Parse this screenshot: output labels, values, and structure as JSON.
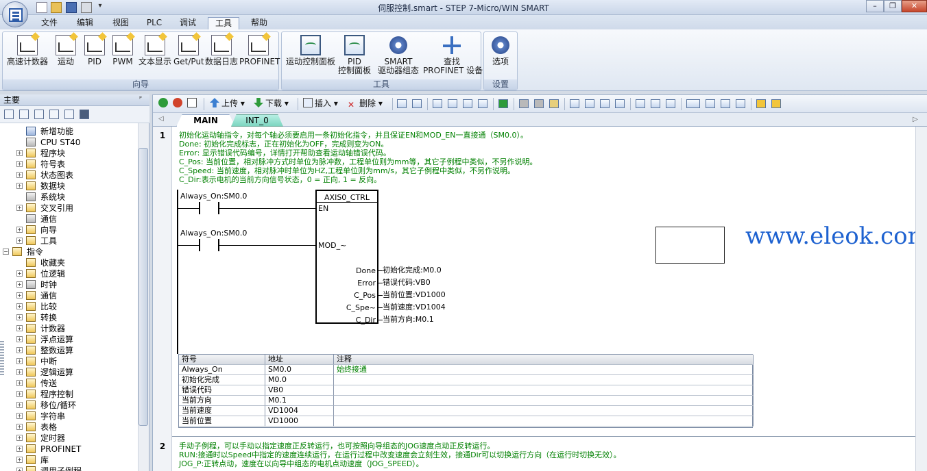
{
  "window": {
    "title": "伺服控制.smart - STEP 7-Micro/WIN SMART",
    "controls": {
      "minimize": "–",
      "maximize": "❐",
      "close": "✕"
    }
  },
  "quick_access": {
    "more": "▾"
  },
  "menu_tabs": [
    {
      "label": "文件",
      "active": false
    },
    {
      "label": "编辑",
      "active": false
    },
    {
      "label": "视图",
      "active": false
    },
    {
      "label": "PLC",
      "active": false
    },
    {
      "label": "调试",
      "active": false
    },
    {
      "label": "工具",
      "active": true
    },
    {
      "label": "帮助",
      "active": false
    }
  ],
  "ribbon": {
    "groups": [
      {
        "label": "向导",
        "buttons": [
          "高速计数器",
          "运动",
          "PID",
          "PWM",
          "文本显示",
          "Get/Put",
          "数据日志",
          "PROFINET"
        ]
      },
      {
        "label": "工具",
        "buttons": [
          "运动控制面板",
          "PID\n控制面板",
          "SMART\n驱动器组态",
          "查找\nPROFINET 设备"
        ]
      },
      {
        "label": "设置",
        "buttons": [
          "选项"
        ]
      }
    ],
    "accent_color": "#f2c53a"
  },
  "left_panel": {
    "title": "主要",
    "pin": "ᴾ",
    "tree": [
      {
        "label": "新增功能",
        "indent": 1,
        "expander": "",
        "icon": "question-icon"
      },
      {
        "label": "CPU ST40",
        "indent": 1,
        "expander": "",
        "icon": "cpu-icon"
      },
      {
        "label": "程序块",
        "indent": 1,
        "expander": "+",
        "icon": "folder-icon"
      },
      {
        "label": "符号表",
        "indent": 1,
        "expander": "+",
        "icon": "folder-icon"
      },
      {
        "label": "状态图表",
        "indent": 1,
        "expander": "+",
        "icon": "folder-icon"
      },
      {
        "label": "数据块",
        "indent": 1,
        "expander": "+",
        "icon": "folder-icon"
      },
      {
        "label": "系统块",
        "indent": 1,
        "expander": "",
        "icon": "page-icon"
      },
      {
        "label": "交叉引用",
        "indent": 1,
        "expander": "+",
        "icon": "folder-icon"
      },
      {
        "label": "通信",
        "indent": 1,
        "expander": "",
        "icon": "network-icon"
      },
      {
        "label": "向导",
        "indent": 1,
        "expander": "+",
        "icon": "wand-icon"
      },
      {
        "label": "工具",
        "indent": 1,
        "expander": "+",
        "icon": "folder-icon"
      },
      {
        "label": "指令",
        "indent": 0,
        "expander": "−",
        "icon": "folder-icon"
      },
      {
        "label": "收藏夹",
        "indent": 1,
        "expander": "",
        "icon": "folder-icon"
      },
      {
        "label": "位逻辑",
        "indent": 1,
        "expander": "+",
        "icon": "folder-icon"
      },
      {
        "label": "时钟",
        "indent": 1,
        "expander": "+",
        "icon": "clock-icon"
      },
      {
        "label": "通信",
        "indent": 1,
        "expander": "+",
        "icon": "folder-icon"
      },
      {
        "label": "比较",
        "indent": 1,
        "expander": "+",
        "icon": "folder-icon"
      },
      {
        "label": "转换",
        "indent": 1,
        "expander": "+",
        "icon": "folder-icon"
      },
      {
        "label": "计数器",
        "indent": 1,
        "expander": "+",
        "icon": "folder-icon"
      },
      {
        "label": "浮点运算",
        "indent": 1,
        "expander": "+",
        "icon": "folder-icon"
      },
      {
        "label": "整数运算",
        "indent": 1,
        "expander": "+",
        "icon": "folder-icon"
      },
      {
        "label": "中断",
        "indent": 1,
        "expander": "+",
        "icon": "folder-icon"
      },
      {
        "label": "逻辑运算",
        "indent": 1,
        "expander": "+",
        "icon": "folder-icon"
      },
      {
        "label": "传送",
        "indent": 1,
        "expander": "+",
        "icon": "folder-icon"
      },
      {
        "label": "程序控制",
        "indent": 1,
        "expander": "+",
        "icon": "folder-icon"
      },
      {
        "label": "移位/循环",
        "indent": 1,
        "expander": "+",
        "icon": "folder-icon"
      },
      {
        "label": "字符串",
        "indent": 1,
        "expander": "+",
        "icon": "folder-icon"
      },
      {
        "label": "表格",
        "indent": 1,
        "expander": "+",
        "icon": "folder-icon"
      },
      {
        "label": "定时器",
        "indent": 1,
        "expander": "+",
        "icon": "folder-icon"
      },
      {
        "label": "PROFINET",
        "indent": 1,
        "expander": "+",
        "icon": "folder-icon"
      },
      {
        "label": "库",
        "indent": 1,
        "expander": "+",
        "icon": "folder-icon"
      },
      {
        "label": "调用子例程",
        "indent": 1,
        "expander": "+",
        "icon": "folder-icon"
      }
    ]
  },
  "editor_toolbar": {
    "upload": "上传",
    "download": "下载",
    "insert": "插入",
    "delete": "删除",
    "dropdown": "▾"
  },
  "editor_tabs": [
    {
      "label": "MAIN",
      "active": true
    },
    {
      "label": "INT_0",
      "active": false
    }
  ],
  "network1": {
    "number": "1",
    "comments": [
      "初始化运动轴指令，对每个轴必须要启用一条初始化指令，并且保证EN和MOD_EN一直接通（SM0.0）。",
      "Done: 初始化完成标志，正在初始化为OFF，完成则变为ON。",
      "Error: 显示错误代码编号，详情打开帮助查看运动轴错误代码。",
      "C_Pos: 当前位置，相对脉冲方式时单位为脉冲数，工程单位则为mm等，其它子例程中类似，不另作说明。",
      "C_Speed: 当前速度，相对脉冲时单位为HZ,工程单位则为mm/s，其它子例程中类似，不另作说明。",
      "C_Dir:表示电机的当前方向信号状态，0 = 正向, 1 = 反向。"
    ],
    "contact1": "Always_On:SM0.0",
    "contact2": "Always_On:SM0.0",
    "block": {
      "title": "AXIS0_CTRL",
      "inputs": [
        "EN",
        "MOD_~"
      ],
      "outputs": [
        {
          "pin": "Done",
          "operand": "初始化完成:M0.0"
        },
        {
          "pin": "Error",
          "operand": "错误代码:VB0"
        },
        {
          "pin": "C_Pos",
          "operand": "当前位置:VD1000"
        },
        {
          "pin": "C_Spe~",
          "operand": "当前速度:VD1004"
        },
        {
          "pin": "C_Dir",
          "operand": "当前方向:M0.1"
        }
      ]
    },
    "symbol_table": {
      "headers": [
        "符号",
        "地址",
        "注释"
      ],
      "rows": [
        [
          "Always_On",
          "SM0.0",
          "始终接通"
        ],
        [
          "初始化完成",
          "M0.0",
          ""
        ],
        [
          "错误代码",
          "VB0",
          ""
        ],
        [
          "当前方向",
          "M0.1",
          ""
        ],
        [
          "当前速度",
          "VD1004",
          ""
        ],
        [
          "当前位置",
          "VD1000",
          ""
        ]
      ]
    }
  },
  "network2": {
    "number": "2",
    "comments": [
      "手动子例程，可以手动以指定速度正反转运行，也可按照向导组态的JOG速度点动正反转运行。",
      "RUN:接通时以Speed中指定的速度连续运行，在运行过程中改变速度会立刻生效，接通Dir可以切换运行方向（在运行时切换无效）。",
      "JOG_P:正转点动，速度在以向导中组态的电机点动速度（JOG_SPEED）。"
    ]
  },
  "watermark": "www.eleok.com"
}
